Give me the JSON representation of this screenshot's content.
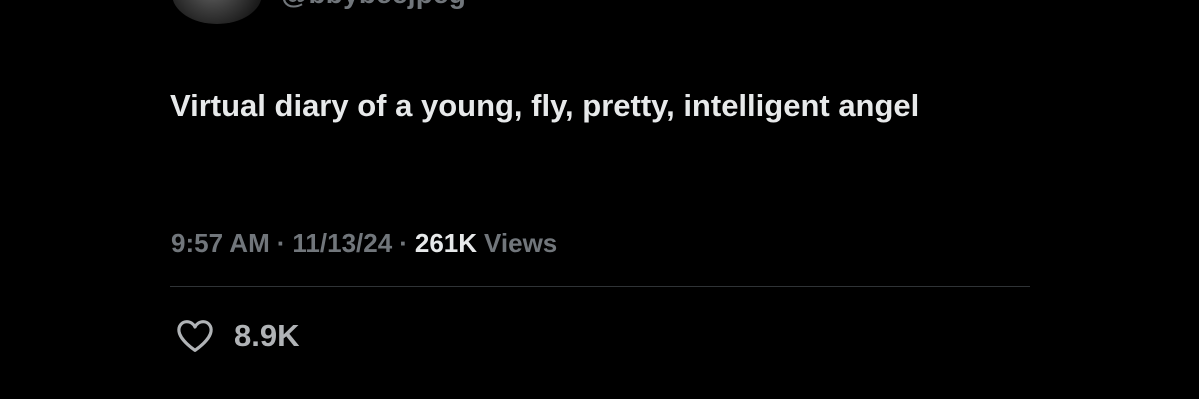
{
  "author": {
    "handle": "@bbybeejpeg"
  },
  "tweet": {
    "text": "Virtual diary of a young, fly, pretty, intelligent angel"
  },
  "meta": {
    "time": "9:57 AM",
    "separator": "·",
    "date": "11/13/24",
    "views_count": "261K",
    "views_label": "Views"
  },
  "actions": {
    "like_icon": "heart-outline-icon",
    "like_count": "8.9K"
  },
  "colors": {
    "background": "#000000",
    "primary_text": "#e7e9ea",
    "secondary_text": "#71767b",
    "divider": "#2f3336"
  }
}
